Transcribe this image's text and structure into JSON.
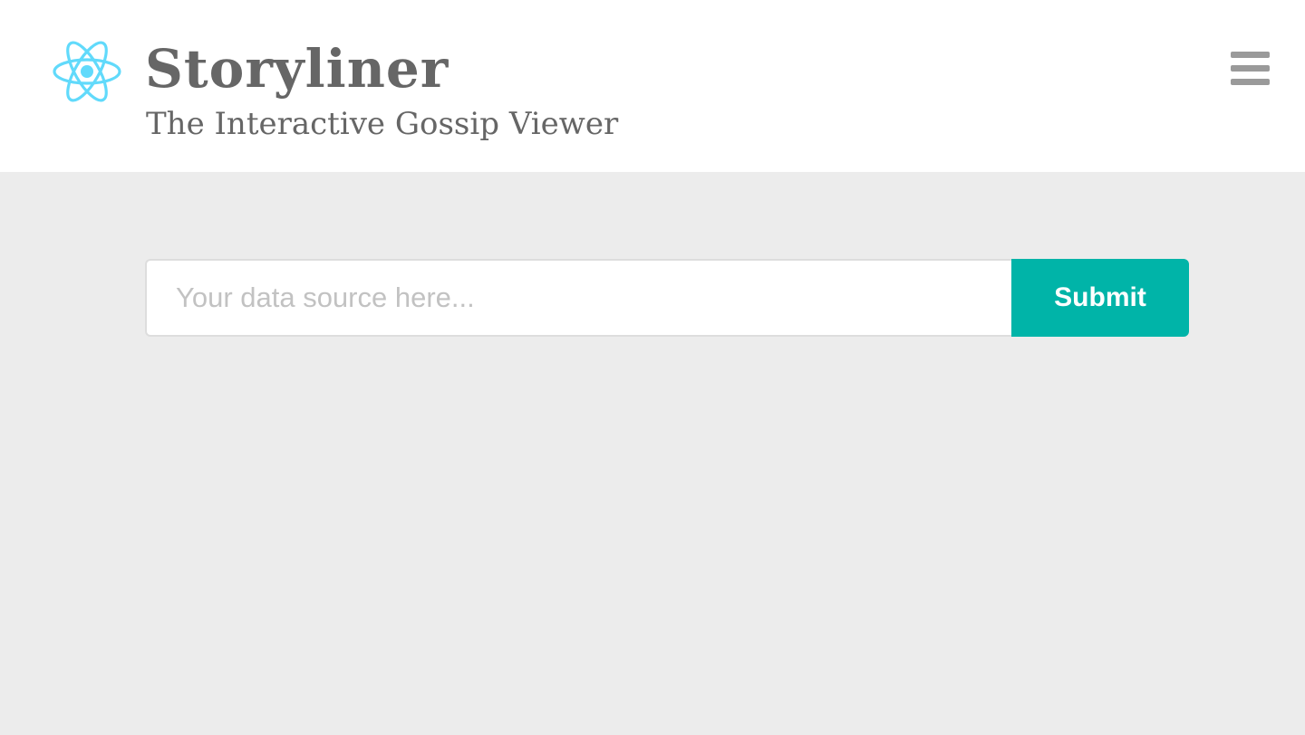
{
  "header": {
    "logo_icon": "react-atom-icon",
    "logo_color": "#61dafb",
    "title": "Storyliner",
    "subtitle": "The Interactive Gossip Viewer",
    "menu_icon": "hamburger-menu-icon",
    "menu_color": "#9a9a9a"
  },
  "main": {
    "data_source_input": {
      "value": "",
      "placeholder": "Your data source here..."
    },
    "submit_label": "Submit",
    "accent_color": "#00b4a8",
    "background_color": "#ececec"
  }
}
